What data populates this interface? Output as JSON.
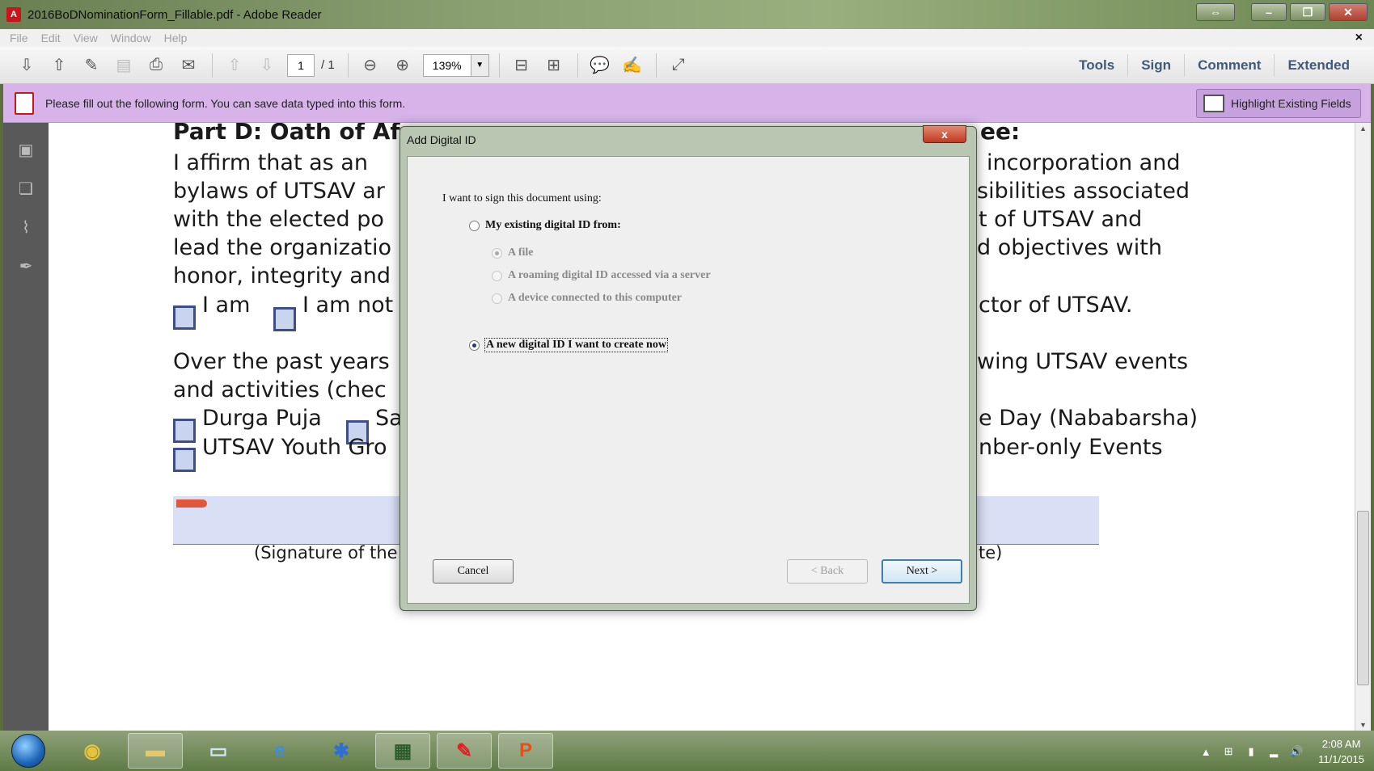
{
  "window": {
    "title": "2016BoDNominationForm_Fillable.pdf - Adobe Reader",
    "app_icon_text": "A"
  },
  "menu": {
    "items": [
      "File",
      "Edit",
      "View",
      "Window",
      "Help"
    ],
    "close_doc": "×"
  },
  "toolbar": {
    "page_current": "1",
    "page_total": "/ 1",
    "zoom": "139%",
    "panels": [
      "Tools",
      "Sign",
      "Comment",
      "Extended"
    ]
  },
  "formbar": {
    "message": "Please fill out the following form. You can save data typed into this form.",
    "highlight_label": "Highlight Existing Fields"
  },
  "document": {
    "heading": "Part D: Oath of Af",
    "heading_right": "ee:",
    "left_lines": [
      "I affirm that as an",
      "bylaws of UTSAV ar",
      "with the elected po",
      "lead the organizatio",
      "honor, integrity and"
    ],
    "right_lines": [
      "incorporation and",
      "sibilities associated",
      "t of UTSAV and",
      "d objectives with"
    ],
    "i_am": "I am",
    "i_am_not": "I am not",
    "director_tail": "ctor of UTSAV.",
    "over_past": "Over the past years",
    "activities": "and activities (chec",
    "events_tail": "wing UTSAV events",
    "durga": "Durga Puja",
    "sa": "Sa",
    "new_year": "e Day (Nababarsha)",
    "youth": "UTSAV Youth Gro",
    "member_only": "nber-only Events",
    "sig_left": "(Signature of the",
    "sig_right": "te)"
  },
  "dialog": {
    "title": "Add Digital ID",
    "close": "x",
    "prompt": "I want to sign this document using:",
    "options": {
      "existing": "My existing digital ID from:",
      "file": "A file",
      "roaming": "A roaming digital ID accessed via a server",
      "device": "A device connected to this computer",
      "new_id": "A new digital ID I want to create now"
    },
    "buttons": {
      "cancel": "Cancel",
      "back": "< Back",
      "next": "Next >"
    }
  },
  "taskbar": {
    "time": "2:08 AM",
    "date": "11/1/2015"
  }
}
